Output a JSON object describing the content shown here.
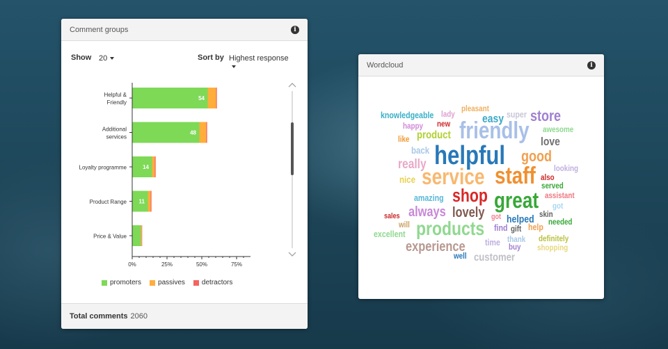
{
  "comment_groups": {
    "title": "Comment groups",
    "show_label": "Show",
    "show_value": "20",
    "sort_label": "Sort by",
    "sort_value": "Highest response",
    "legend": [
      {
        "label": "promoters",
        "color": "#7ed957"
      },
      {
        "label": "passives",
        "color": "#ffad3b"
      },
      {
        "label": "detractors",
        "color": "#f4645f"
      }
    ],
    "footer_label": "Total comments",
    "footer_value": "2060"
  },
  "chart_data": {
    "type": "bar",
    "orientation": "horizontal",
    "stacked": true,
    "categories": [
      "Helpful &\nFriendly",
      "Additional\nservices",
      "Loyalty programme",
      "Product Range",
      "Price & Value"
    ],
    "series": [
      {
        "name": "promoters",
        "values": [
          54,
          48,
          14,
          11,
          6
        ],
        "color": "#7ed957"
      },
      {
        "name": "passives",
        "values": [
          6,
          5,
          2,
          2,
          0.6
        ],
        "color": "#ffad3b"
      },
      {
        "name": "detractors",
        "values": [
          0.6,
          0.6,
          0.6,
          0.6,
          0.3
        ],
        "color": "#f4645f"
      }
    ],
    "data_labels": [
      "54",
      "48",
      "14",
      "11",
      ""
    ],
    "x_ticks": [
      "0%",
      "25%",
      "50%",
      "75%"
    ],
    "xlim": [
      0,
      85
    ],
    "grid": false,
    "legend_position": "bottom"
  },
  "wordcloud": {
    "title": "Wordcloud",
    "words": [
      {
        "text": "knowledgeable",
        "color": "#3ab0c8",
        "size": 13
      },
      {
        "text": "lady",
        "color": "#e0a0d0",
        "size": 12
      },
      {
        "text": "pleasant",
        "color": "#f0b060",
        "size": 12
      },
      {
        "text": "super",
        "color": "#c8c8d8",
        "size": 13
      },
      {
        "text": "store",
        "color": "#a080d0",
        "size": 22
      },
      {
        "text": "happy",
        "color": "#d08ad8",
        "size": 12
      },
      {
        "text": "new",
        "color": "#d02828",
        "size": 12
      },
      {
        "text": "easy",
        "color": "#3aa8c8",
        "size": 17
      },
      {
        "text": "awesome",
        "color": "#90d890",
        "size": 12
      },
      {
        "text": "like",
        "color": "#f09830",
        "size": 12
      },
      {
        "text": "product",
        "color": "#b0d030",
        "size": 16
      },
      {
        "text": "friendly",
        "color": "#a8c0e8",
        "size": 34
      },
      {
        "text": "love",
        "color": "#707070",
        "size": 17
      },
      {
        "text": "back",
        "color": "#a8c8e8",
        "size": 14
      },
      {
        "text": "helpful",
        "color": "#2878b8",
        "size": 38
      },
      {
        "text": "good",
        "color": "#f0a050",
        "size": 22
      },
      {
        "text": "really",
        "color": "#e8a8c8",
        "size": 19
      },
      {
        "text": "looking",
        "color": "#c0b0e0",
        "size": 12
      },
      {
        "text": "nice",
        "color": "#e8d050",
        "size": 14
      },
      {
        "text": "service",
        "color": "#f8b870",
        "size": 32
      },
      {
        "text": "staff",
        "color": "#f09030",
        "size": 34
      },
      {
        "text": "also",
        "color": "#d02828",
        "size": 12
      },
      {
        "text": "served",
        "color": "#38a838",
        "size": 12
      },
      {
        "text": "assistant",
        "color": "#f07880",
        "size": 12
      },
      {
        "text": "amazing",
        "color": "#58b8d8",
        "size": 13
      },
      {
        "text": "shop",
        "color": "#d82828",
        "size": 26
      },
      {
        "text": "great",
        "color": "#38a838",
        "size": 32
      },
      {
        "text": "got",
        "color": "#a8d8f0",
        "size": 12
      },
      {
        "text": "sales",
        "color": "#c82828",
        "size": 11
      },
      {
        "text": "always",
        "color": "#c888d8",
        "size": 20
      },
      {
        "text": "lovely",
        "color": "#805850",
        "size": 20
      },
      {
        "text": "skin",
        "color": "#606060",
        "size": 12
      },
      {
        "text": "will",
        "color": "#c8a060",
        "size": 12
      },
      {
        "text": "got",
        "color": "#f08090",
        "size": 11
      },
      {
        "text": "helped",
        "color": "#2878b8",
        "size": 15
      },
      {
        "text": "needed",
        "color": "#38a838",
        "size": 12
      },
      {
        "text": "excellent",
        "color": "#90d890",
        "size": 13
      },
      {
        "text": "products",
        "color": "#90d890",
        "size": 28
      },
      {
        "text": "find",
        "color": "#a080d0",
        "size": 13
      },
      {
        "text": "gift",
        "color": "#606060",
        "size": 12
      },
      {
        "text": "help",
        "color": "#f0a050",
        "size": 13
      },
      {
        "text": "thank",
        "color": "#a8c8e8",
        "size": 12
      },
      {
        "text": "definitely",
        "color": "#b8c040",
        "size": 12
      },
      {
        "text": "experience",
        "color": "#b89890",
        "size": 20
      },
      {
        "text": "time",
        "color": "#c0b0e0",
        "size": 13
      },
      {
        "text": "buy",
        "color": "#a080d0",
        "size": 12
      },
      {
        "text": "shopping",
        "color": "#e8d880",
        "size": 12
      },
      {
        "text": "well",
        "color": "#2878b8",
        "size": 12
      },
      {
        "text": "customer",
        "color": "#c0c0c8",
        "size": 16
      }
    ]
  }
}
